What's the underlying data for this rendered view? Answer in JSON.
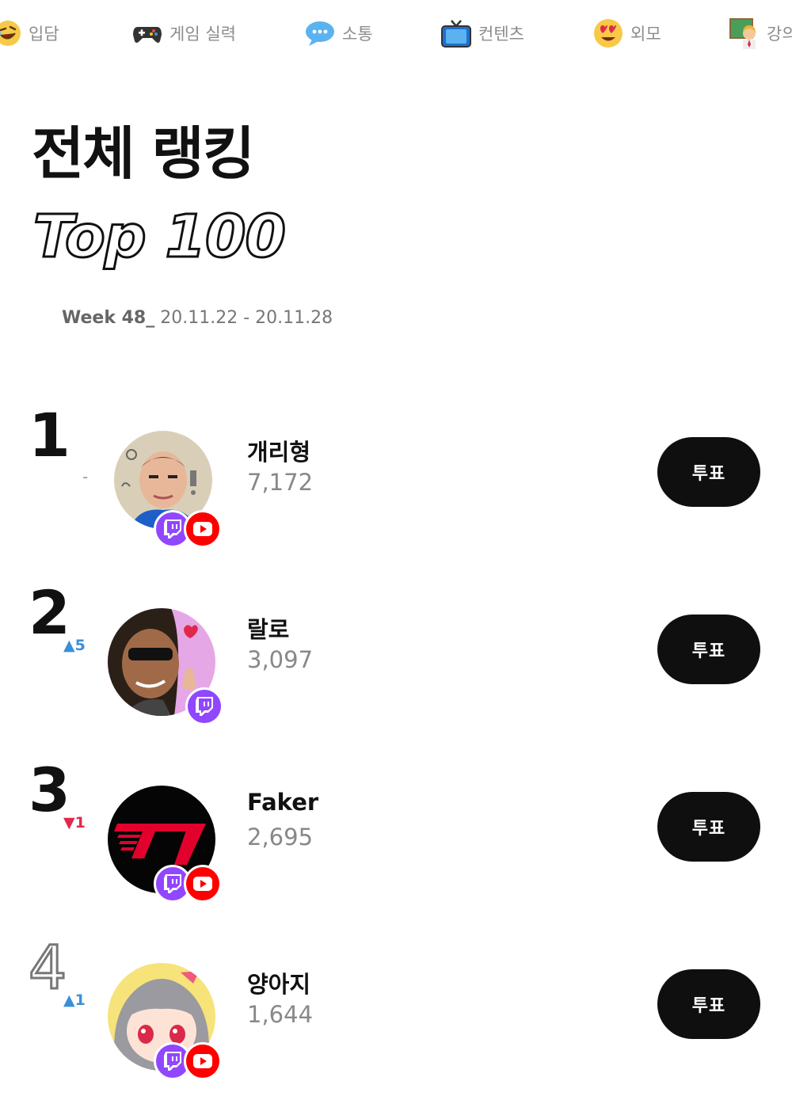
{
  "categories": [
    {
      "label": "입담",
      "icon": "rolling-laughing-face-icon"
    },
    {
      "label": "게임 실력",
      "icon": "game-controller-icon"
    },
    {
      "label": "소통",
      "icon": "speech-bubble-icon"
    },
    {
      "label": "컨텐츠",
      "icon": "television-icon"
    },
    {
      "label": "외모",
      "icon": "heart-eyes-face-icon"
    },
    {
      "label": "강의",
      "icon": "teacher-icon"
    }
  ],
  "heading": {
    "title": "전체 랭킹",
    "subtitle": "Top 100",
    "week_label": "Week 48_",
    "week_range": "20.11.22 - 20.11.28"
  },
  "rankings": [
    {
      "rank": "1",
      "change": "-",
      "change_dir": "same",
      "name": "개리형",
      "score": "7,172",
      "vote_label": "투표",
      "platforms": [
        "twitch",
        "youtube"
      ]
    },
    {
      "rank": "2",
      "change": "▲5",
      "change_dir": "up",
      "name": "랄로",
      "score": "3,097",
      "vote_label": "투표",
      "platforms": [
        "twitch"
      ]
    },
    {
      "rank": "3",
      "change": "▼1",
      "change_dir": "down",
      "name": "Faker",
      "score": "2,695",
      "vote_label": "투표",
      "platforms": [
        "twitch",
        "youtube"
      ]
    },
    {
      "rank": "4",
      "change": "▲1",
      "change_dir": "up",
      "name": "양아지",
      "score": "1,644",
      "vote_label": "투표",
      "platforms": [
        "twitch",
        "youtube"
      ]
    }
  ],
  "colors": {
    "up": "#3a8fd9",
    "down": "#e0294a",
    "twitch": "#9146ff",
    "youtube": "#ff0000",
    "vote_button": "#0f0f0f"
  }
}
